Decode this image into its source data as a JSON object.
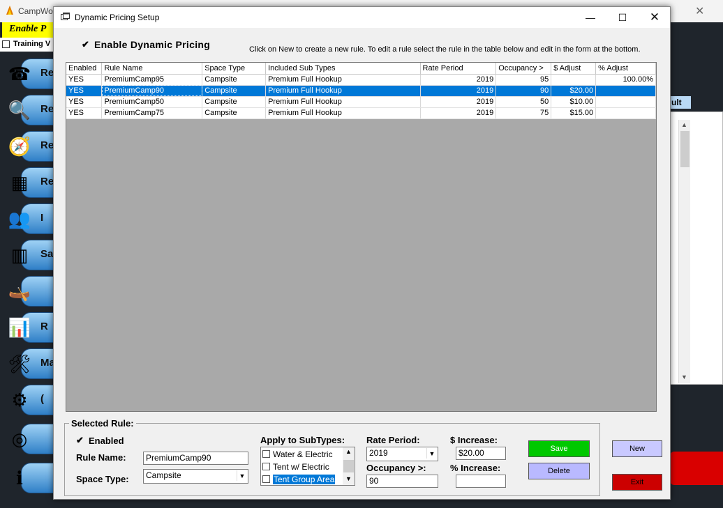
{
  "background_app": {
    "title": "CampWo",
    "enable_banner": "Enable P",
    "training_label": "Training V",
    "result_button": "ult",
    "side_buttons": [
      {
        "icon": "phone-icon",
        "glyph": "☎",
        "label": "Re"
      },
      {
        "icon": "magnifier-icon",
        "glyph": "🔍",
        "label": "Re"
      },
      {
        "icon": "compass-icon",
        "glyph": "🧭",
        "label": "Re"
      },
      {
        "icon": "calendar-grid-icon",
        "glyph": "▦",
        "label": "Re"
      },
      {
        "icon": "people-icon",
        "glyph": "👥",
        "label": "I"
      },
      {
        "icon": "barcode-icon",
        "glyph": "▥",
        "label": "Sa"
      },
      {
        "icon": "boat-icon",
        "glyph": "🛶",
        "label": ""
      },
      {
        "icon": "bar-chart-icon",
        "glyph": "📊",
        "label": "R"
      },
      {
        "icon": "tools-icon",
        "glyph": "🛠",
        "label": "Ma"
      },
      {
        "icon": "gears-icon",
        "glyph": "⚙",
        "label": "("
      },
      {
        "icon": "life-ring-icon",
        "glyph": "◎",
        "label": ""
      },
      {
        "icon": "info-icon",
        "glyph": "ℹ",
        "label": ""
      }
    ]
  },
  "dialog": {
    "title": "Dynamic Pricing Setup",
    "min_glyph": "—",
    "max_glyph": "☐",
    "close_glyph": "✕",
    "enable_dynamic_pricing": {
      "label": "Enable Dynamic Pricing",
      "checked": true,
      "glyph": "✔"
    },
    "instructions": "Click on New to create a new rule.  To edit a rule select the rule in the table below and edit in the form at the bottom."
  },
  "table": {
    "columns": [
      "Enabled",
      "Rule Name",
      "Space Type",
      "Included Sub Types",
      "Rate Period",
      "Occupancy >",
      "$ Adjust",
      "% Adjust"
    ],
    "rows": [
      {
        "enabled": "YES",
        "rule_name": "PremiumCamp95",
        "space_type": "Campsite",
        "sub_types": "Premium Full Hookup",
        "rate_period": "2019",
        "occupancy": "95",
        "dollar_adjust": "",
        "pct_adjust": "100.00%"
      },
      {
        "enabled": "YES",
        "rule_name": "PremiumCamp90",
        "space_type": "Campsite",
        "sub_types": "Premium Full Hookup",
        "rate_period": "2019",
        "occupancy": "90",
        "dollar_adjust": "$20.00",
        "pct_adjust": ""
      },
      {
        "enabled": "YES",
        "rule_name": "PremiumCamp50",
        "space_type": "Campsite",
        "sub_types": "Premium Full Hookup",
        "rate_period": "2019",
        "occupancy": "50",
        "dollar_adjust": "$10.00",
        "pct_adjust": ""
      },
      {
        "enabled": "YES",
        "rule_name": "PremiumCamp75",
        "space_type": "Campsite",
        "sub_types": "Premium Full Hookup",
        "rate_period": "2019",
        "occupancy": "75",
        "dollar_adjust": "$15.00",
        "pct_adjust": ""
      }
    ],
    "selected_row": 1
  },
  "selected_rule": {
    "legend": "Selected Rule:",
    "enabled_label": "Enabled",
    "enabled_glyph": "✔",
    "rule_name_label": "Rule Name:",
    "rule_name_value": "PremiumCamp90",
    "space_type_label": "Space Type:",
    "space_type_value": "Campsite",
    "apply_subtypes_label": "Apply to SubTypes:",
    "subtypes": [
      "Water & Electric",
      "Tent w/ Electric",
      "Tent Group Area"
    ],
    "subtypes_highlighted": 2,
    "rate_period_label": "Rate Period:",
    "rate_period_value": "2019",
    "occupancy_label": "Occupancy >:",
    "occupancy_value": "90",
    "dollar_increase_label": "$ Increase:",
    "dollar_increase_value": "$20.00",
    "pct_increase_label": "% Increase:",
    "pct_increase_value": ""
  },
  "buttons": {
    "save": "Save",
    "delete": "Delete",
    "new": "New",
    "exit": "Exit"
  },
  "colors": {
    "selection": "#0078d7",
    "save": "#00c800",
    "delete": "#b9b9ff",
    "new": "#c9c9ff",
    "exit": "#cc0000",
    "grid_bg": "#a9a9a9"
  }
}
